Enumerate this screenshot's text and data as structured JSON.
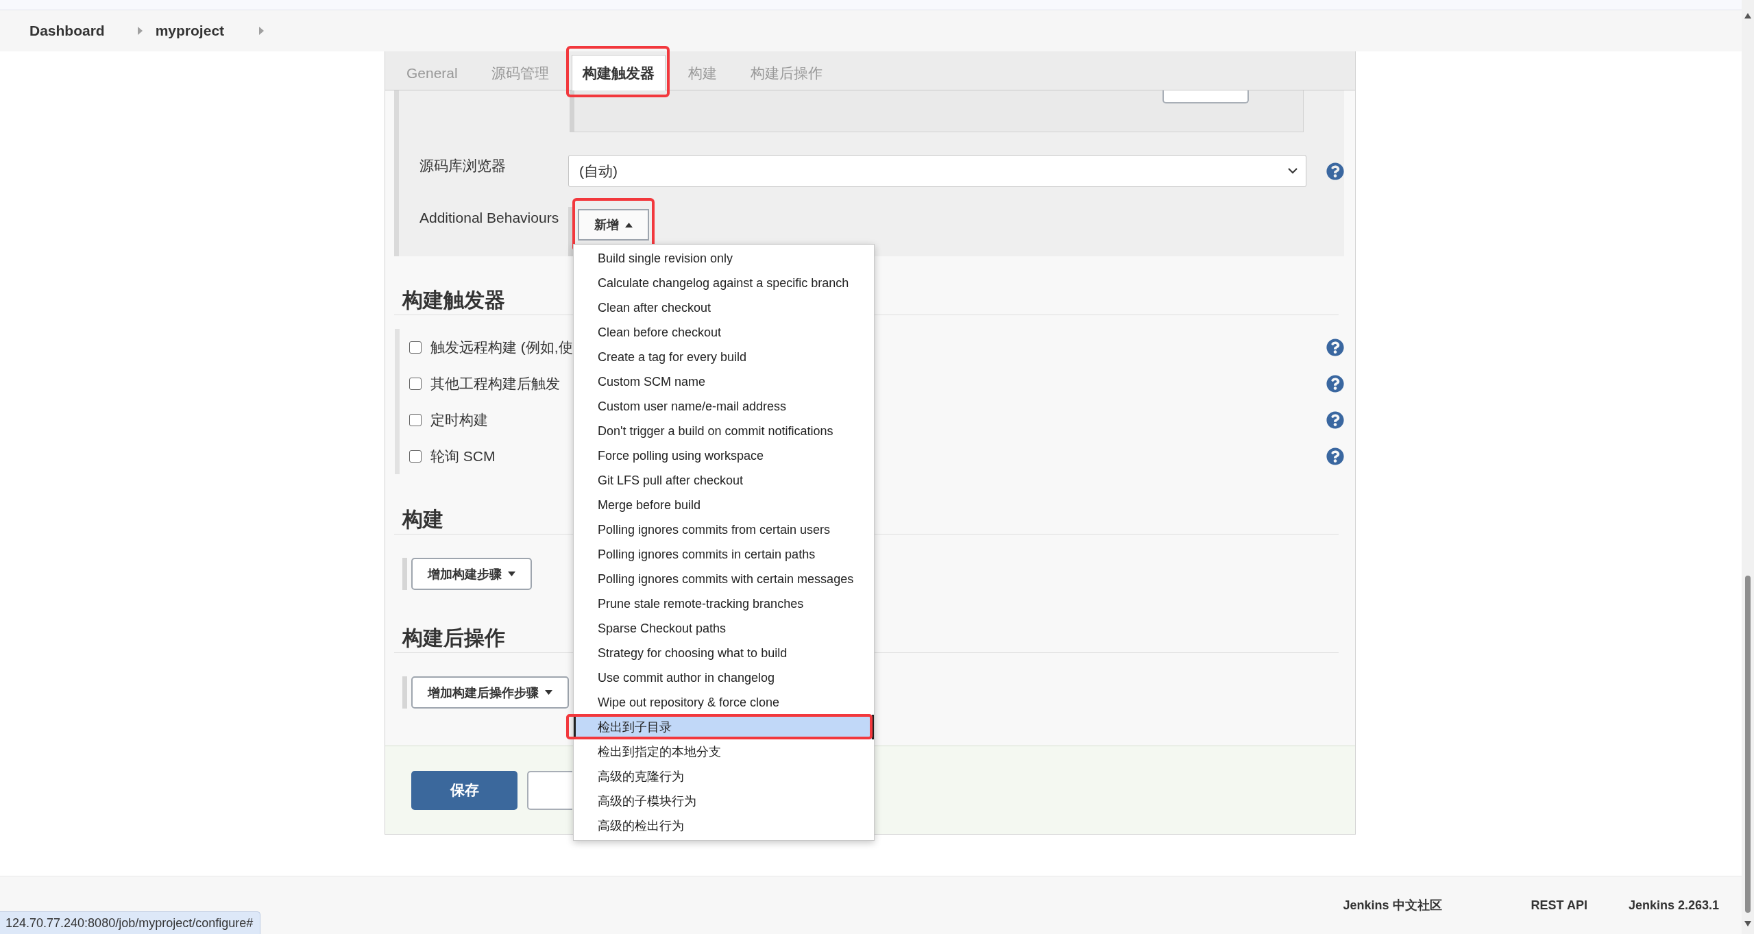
{
  "breadcrumb": [
    {
      "label": "Dashboard"
    },
    {
      "label": "myproject"
    }
  ],
  "tabs": [
    {
      "label": "General",
      "selected": false,
      "highlighted": false
    },
    {
      "label": "源码管理",
      "selected": false,
      "highlighted": false
    },
    {
      "label": "构建触发器",
      "selected": true,
      "highlighted": true
    },
    {
      "label": "构建",
      "selected": false,
      "highlighted": false
    },
    {
      "label": "构建后操作",
      "selected": false,
      "highlighted": false
    }
  ],
  "scm": {
    "branch_box": {
      "buttons": [
        {
          "kind": "cut-off"
        }
      ]
    },
    "fields": [
      {
        "kind": "select",
        "label": "源码库浏览器",
        "value": "(自动)"
      },
      {
        "kind": "add-button",
        "label": "Additional Behaviours",
        "button": "新增",
        "expanded": true,
        "highlighted": true,
        "menu": [
          {
            "label": "Build single revision only",
            "selected": false,
            "highlighted": false
          },
          {
            "label": "Calculate changelog against a specific branch",
            "selected": false,
            "highlighted": false
          },
          {
            "label": "Clean after checkout",
            "selected": false,
            "highlighted": false
          },
          {
            "label": "Clean before checkout",
            "selected": false,
            "highlighted": false
          },
          {
            "label": "Create a tag for every build",
            "selected": false,
            "highlighted": false
          },
          {
            "label": "Custom SCM name",
            "selected": false,
            "highlighted": false
          },
          {
            "label": "Custom user name/e-mail address",
            "selected": false,
            "highlighted": false
          },
          {
            "label": "Don't trigger a build on commit notifications",
            "selected": false,
            "highlighted": false
          },
          {
            "label": "Force polling using workspace",
            "selected": false,
            "highlighted": false
          },
          {
            "label": "Git LFS pull after checkout",
            "selected": false,
            "highlighted": false
          },
          {
            "label": "Merge before build",
            "selected": false,
            "highlighted": false
          },
          {
            "label": "Polling ignores commits from certain users",
            "selected": false,
            "highlighted": false
          },
          {
            "label": "Polling ignores commits in certain paths",
            "selected": false,
            "highlighted": false
          },
          {
            "label": "Polling ignores commits with certain messages",
            "selected": false,
            "highlighted": false
          },
          {
            "label": "Prune stale remote-tracking branches",
            "selected": false,
            "highlighted": false
          },
          {
            "label": "Sparse Checkout paths",
            "selected": false,
            "highlighted": false
          },
          {
            "label": "Strategy for choosing what to build",
            "selected": false,
            "highlighted": false
          },
          {
            "label": "Use commit author in changelog",
            "selected": false,
            "highlighted": false
          },
          {
            "label": "Wipe out repository & force clone",
            "selected": false,
            "highlighted": false
          },
          {
            "label": "检出到子目录",
            "selected": true,
            "highlighted": true
          },
          {
            "label": "检出到指定的本地分支",
            "selected": false,
            "highlighted": false
          },
          {
            "label": "高级的克隆行为",
            "selected": false,
            "highlighted": false
          },
          {
            "label": "高级的子模块行为",
            "selected": false,
            "highlighted": false
          },
          {
            "label": "高级的检出行为",
            "selected": false,
            "highlighted": false
          }
        ]
      }
    ]
  },
  "sections": [
    {
      "title": "构建触发器",
      "kind": "checkboxes",
      "options": [
        {
          "label": "触发远程构建 (例如,使",
          "checked": false
        },
        {
          "label": "其他工程构建后触发",
          "checked": false
        },
        {
          "label": "定时构建",
          "checked": false
        },
        {
          "label": "轮询 SCM",
          "checked": false
        }
      ]
    },
    {
      "title": "构建",
      "kind": "add-step",
      "button": "增加构建步骤"
    },
    {
      "title": "构建后操作",
      "kind": "add-step",
      "button": "增加构建后操作步骤"
    }
  ],
  "actions": [
    {
      "kind": "primary",
      "label": "保存"
    },
    {
      "kind": "covered"
    }
  ],
  "footer": {
    "links": [
      {
        "label": "Jenkins 中文社区"
      },
      {
        "label": "REST API"
      }
    ],
    "version": "Jenkins 2.263.1"
  },
  "status_url": "124.70.77.240:8080/job/myproject/configure#"
}
